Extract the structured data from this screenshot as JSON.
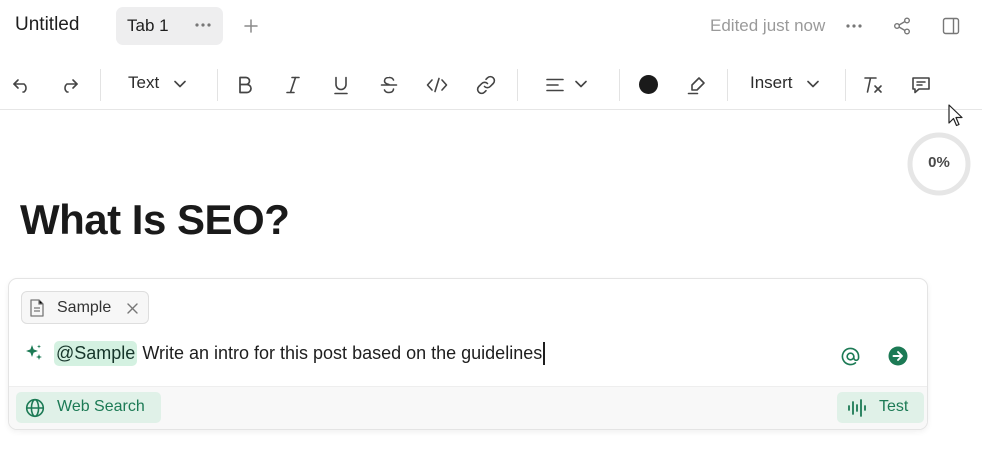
{
  "header": {
    "doc_title": "Untitled",
    "tab_label": "Tab 1",
    "status": "Edited just now"
  },
  "toolbar": {
    "text_style": "Text",
    "insert_label": "Insert",
    "text_color": "#1a1a1a"
  },
  "progress": {
    "label": "0%",
    "value": 0
  },
  "editor": {
    "heading": "What Is SEO?"
  },
  "ai_prompt": {
    "context_chip": "Sample",
    "mention": "@Sample",
    "prompt_text": "Write an intro for this post based on the guidelines",
    "web_search_label": "Web Search",
    "test_label": "Test",
    "accent_color": "#1c7a55"
  },
  "icons": [
    "more-icon",
    "plus-icon",
    "share-icon",
    "panel-icon",
    "undo-icon",
    "redo-icon",
    "chevron-down-icon",
    "bold-icon",
    "italic-icon",
    "underline-icon",
    "strikethrough-icon",
    "code-icon",
    "link-icon",
    "align-left-icon",
    "highlighter-icon",
    "clear-format-icon",
    "comment-icon",
    "document-icon",
    "close-icon",
    "sparkle-icon",
    "at-icon",
    "send-icon",
    "globe-icon",
    "audio-wave-icon"
  ]
}
